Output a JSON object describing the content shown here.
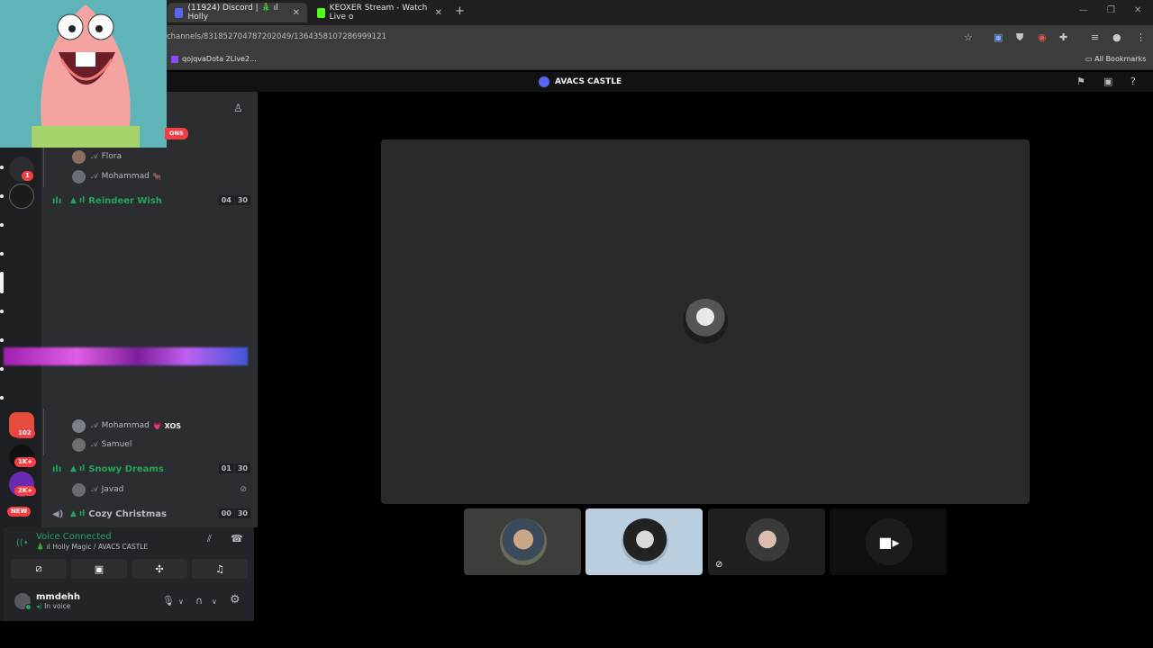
{
  "browser": {
    "tabs": [
      {
        "title": "(11924) Discord | 🎄 ıl Holly",
        "active": true,
        "favicon_color": "#5865f2"
      },
      {
        "title": "KEOXER Stream - Watch Live o",
        "active": false,
        "favicon_color": "#53fc18"
      }
    ],
    "new_tab": "+",
    "url": "channels/831852704787202049/1364358107286999121",
    "bookmarks": [
      {
        "label": "qojqvaDota 2Live2..."
      }
    ],
    "all_bookmarks_label": "All Bookmarks"
  },
  "discord": {
    "server_name": "AVACS CASTLE",
    "rail": {
      "badges": [
        "1",
        "102",
        "1K+",
        "2K+",
        "NEW"
      ]
    },
    "sidebar": {
      "ons_tag": "ONS",
      "members_top": [
        {
          "name": "Flora",
          "extra": ""
        },
        {
          "name": "Mohammad",
          "extra": "🐂"
        }
      ],
      "channels": [
        {
          "name": "Reindeer Wish",
          "count_a": "04",
          "count_b": "30"
        },
        {
          "name": "Snowy Dreams",
          "count_a": "01",
          "count_b": "30"
        },
        {
          "name": "Cozy Christmas",
          "count_a": "00",
          "count_b": "30"
        }
      ],
      "members_mid": [
        {
          "name": "Mohammad",
          "extra": "💗 XOS"
        },
        {
          "name": "Samuel",
          "extra": ""
        }
      ],
      "members_snowy": [
        {
          "name": "Javad",
          "extra": ""
        }
      ]
    },
    "voice_panel": {
      "title": "Voice Connected",
      "subtitle": "🎄 ıl Holly Magic / AVACS CASTLE"
    },
    "user": {
      "name": "mmdehh",
      "status": "In voice"
    }
  },
  "colors": {
    "accent_green": "#23a55a",
    "stage_tile": "#2a2a2b",
    "rail_bg": "#1e1f22",
    "sidebar_bg": "#2b2d31"
  },
  "icons": {
    "voice": "signal-bars-icon",
    "disconnect": "phone-hangup-icon",
    "camera": "camera-icon"
  }
}
